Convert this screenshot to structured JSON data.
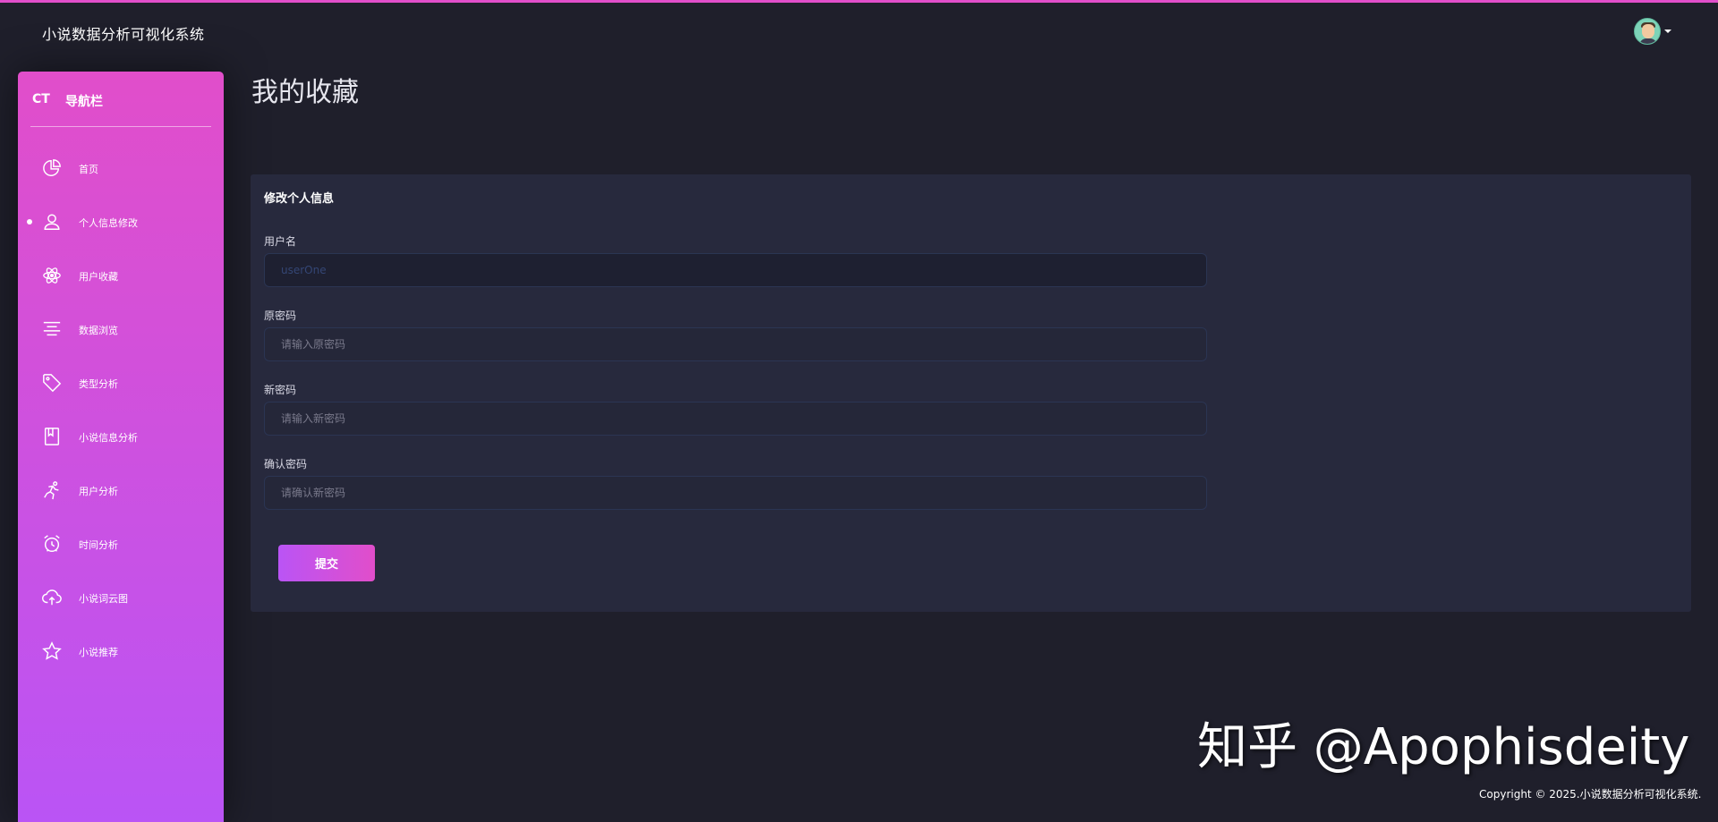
{
  "app": {
    "brand": "小说数据分析可视化系统"
  },
  "sidebar": {
    "mini": "CT",
    "title": "导航栏",
    "items": [
      {
        "label": "首页",
        "icon": "chart-pie-icon"
      },
      {
        "label": "个人信息修改",
        "icon": "user-icon",
        "active": true
      },
      {
        "label": "用户收藏",
        "icon": "atom-icon"
      },
      {
        "label": "数据浏览",
        "icon": "align-center-icon"
      },
      {
        "label": "类型分析",
        "icon": "tag-icon"
      },
      {
        "label": "小说信息分析",
        "icon": "book-icon"
      },
      {
        "label": "用户分析",
        "icon": "running-icon"
      },
      {
        "label": "时间分析",
        "icon": "alarm-clock-icon"
      },
      {
        "label": "小说词云图",
        "icon": "cloud-upload-icon"
      },
      {
        "label": "小说推荐",
        "icon": "star-icon"
      }
    ]
  },
  "main": {
    "page_title": "我的收藏",
    "form": {
      "title": "修改个人信息",
      "username_label": "用户名",
      "username_value": "userOne",
      "old_password_label": "原密码",
      "old_password_placeholder": "请输入原密码",
      "new_password_label": "新密码",
      "new_password_placeholder": "请输入新密码",
      "confirm_password_label": "确认密码",
      "confirm_password_placeholder": "请确认新密码",
      "submit_label": "提交"
    }
  },
  "footer": {
    "watermark": "知乎 @Apophisdeity",
    "copyright": "Copyright © 2025.小说数据分析可视化系统."
  },
  "colors": {
    "background": "#1f1f2b",
    "card": "#27293d",
    "sidebar_top": "#e14eca",
    "sidebar_bottom": "#ba54f5"
  }
}
